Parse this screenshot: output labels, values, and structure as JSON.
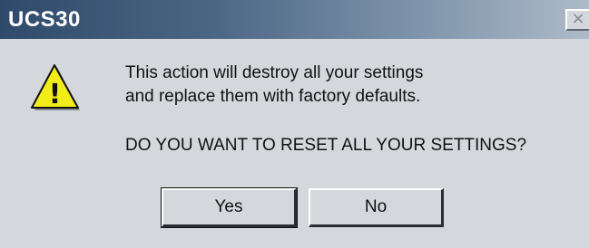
{
  "window": {
    "title": "UCS30",
    "close_glyph": "×"
  },
  "icon": {
    "name": "warning-icon",
    "glyph": "!"
  },
  "message": {
    "line1": "This action will destroy all your settings",
    "line2": "and replace them with factory defaults.",
    "question": "DO YOU WANT TO RESET ALL YOUR SETTINGS?"
  },
  "buttons": {
    "yes": "Yes",
    "no": "No"
  },
  "colors": {
    "titlebar_start": "#2f4a6a",
    "titlebar_end": "#aebac8",
    "dialog_bg": "#d4d8dd",
    "warning_fill": "#f2ec1a"
  }
}
